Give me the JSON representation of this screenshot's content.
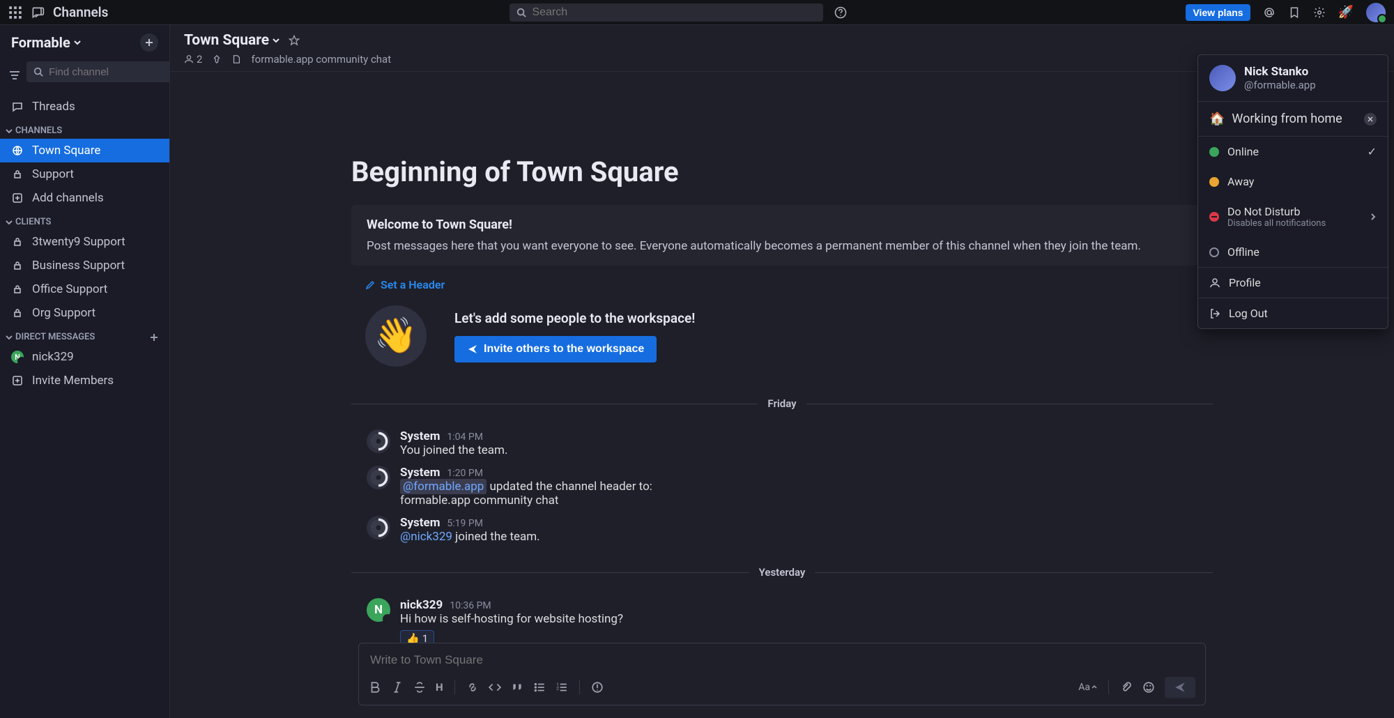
{
  "topbar": {
    "title": "Channels",
    "search_placeholder": "Search",
    "view_plans": "View plans"
  },
  "workspace": {
    "name": "Formable",
    "find_placeholder": "Find channel"
  },
  "sidebar": {
    "threads": "Threads",
    "sections": {
      "channels": "CHANNELS",
      "clients": "CLIENTS",
      "direct_messages": "DIRECT MESSAGES"
    },
    "channels": [
      {
        "name": "Town Square",
        "type": "globe",
        "active": true
      },
      {
        "name": "Support",
        "type": "lock"
      },
      {
        "name": "Add channels",
        "type": "plus"
      }
    ],
    "clients": [
      {
        "name": "3twenty9 Support",
        "type": "lock"
      },
      {
        "name": "Business Support",
        "type": "lock"
      },
      {
        "name": "Office Support",
        "type": "lock"
      },
      {
        "name": "Org Support",
        "type": "lock"
      }
    ],
    "dms": [
      {
        "name": "nick329",
        "initial": "N"
      }
    ],
    "invite_members": "Invite Members"
  },
  "channel": {
    "title": "Town Square",
    "member_count": "2",
    "description": "formable.app community chat"
  },
  "beginning": {
    "heading": "Beginning of Town Square",
    "welcome_title": "Welcome to Town Square!",
    "welcome_body": "Post messages here that you want everyone to see. Everyone automatically becomes a permanent member of this channel when they join the team.",
    "set_header": "Set a Header",
    "invite_heading": "Let's add some people to the workspace!",
    "invite_button": "Invite others to the workspace"
  },
  "dividers": {
    "friday": "Friday",
    "yesterday": "Yesterday"
  },
  "messages": [
    {
      "author": "System",
      "time": "1:04 PM",
      "body_prefix": "You",
      "body_rest": " joined the team."
    },
    {
      "author": "System",
      "time": "1:20 PM",
      "mention": "@formable.app",
      "body_rest": " updated the channel header to:",
      "body_line2": "formable.app community chat"
    },
    {
      "author": "System",
      "time": "5:19 PM",
      "mention_link": "@nick329",
      "body_rest": " joined the team."
    },
    {
      "author": "nick329",
      "time": "10:36 PM",
      "body": "Hi how is self-hosting for website hosting?",
      "reaction_emoji": "👍",
      "reaction_count": "1"
    }
  ],
  "composer": {
    "placeholder": "Write to Town Square",
    "font_label": "Aa"
  },
  "user_menu": {
    "name": "Nick Stanko",
    "handle": "@formable.app",
    "status_emoji": "🏠",
    "status_text": "Working from home",
    "online": "Online",
    "away": "Away",
    "dnd": "Do Not Disturb",
    "dnd_sub": "Disables all notifications",
    "offline": "Offline",
    "profile": "Profile",
    "logout": "Log Out"
  }
}
